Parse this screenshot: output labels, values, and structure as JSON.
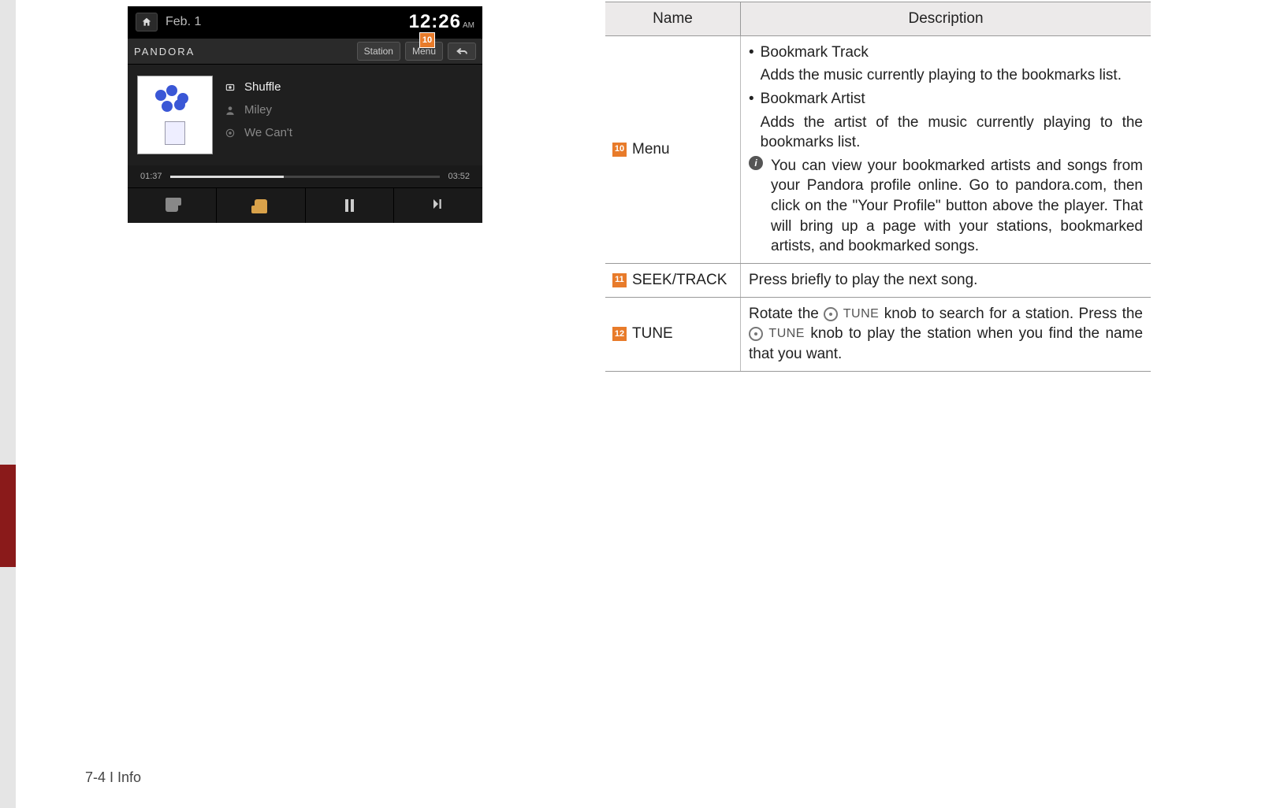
{
  "screenshot": {
    "status": {
      "date": "Feb. 1",
      "time": "12:26",
      "ampm": "AM"
    },
    "app": {
      "brand": "PANDORA",
      "station_btn": "Station",
      "menu_btn": "Menu",
      "callout": "10"
    },
    "track": {
      "station": "Shuffle",
      "artist": "Miley",
      "title": "We Can't",
      "elapsed": "01:37",
      "total": "03:52"
    }
  },
  "table": {
    "head_name": "Name",
    "head_desc": "Description",
    "rows": [
      {
        "num": "10",
        "name": "Menu",
        "bullets": [
          {
            "title": "Bookmark Track",
            "body": "Adds the music currently playing to the book­marks list."
          },
          {
            "title": "Bookmark Artist",
            "body": "Adds the artist of the music currently playing to the bookmarks list."
          }
        ],
        "info": "You can view your bookmarked artists and songs from your Pandora profile online. Go to pandora.com, then click on the \"Your Profile\" button above the player. That will bring up a page with your stations, bookmarked artists, and bookmarked songs."
      },
      {
        "num": "11",
        "name": "SEEK/TRACK",
        "desc": "Press briefly to play the next song."
      },
      {
        "num": "12",
        "name": "TUNE",
        "desc_a": "Rotate the ",
        "desc_b": " knob to search for a station. Press the ",
        "desc_c": " knob to play the station when you find the name that you want.",
        "knob_label": "TUNE"
      }
    ]
  },
  "footer": "7-4 I Info"
}
